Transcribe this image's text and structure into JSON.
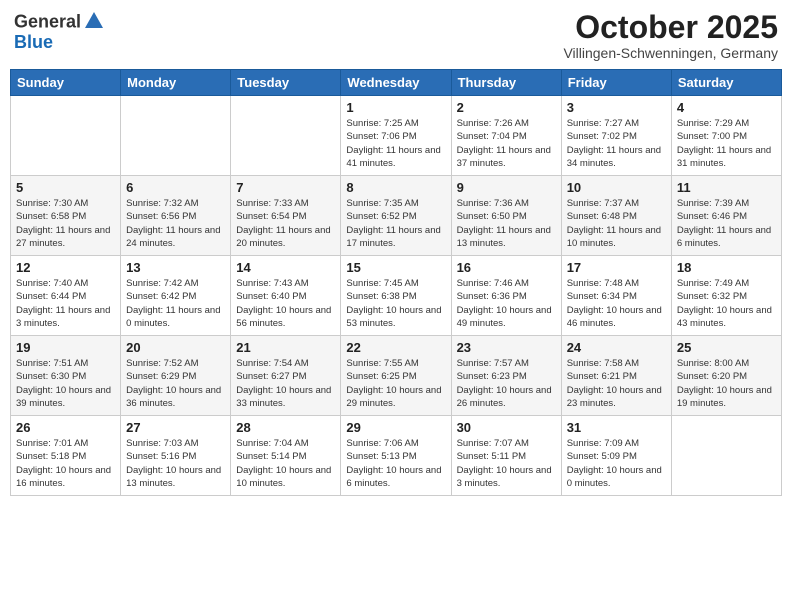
{
  "header": {
    "logo_general": "General",
    "logo_blue": "Blue",
    "month": "October 2025",
    "location": "Villingen-Schwenningen, Germany"
  },
  "weekdays": [
    "Sunday",
    "Monday",
    "Tuesday",
    "Wednesday",
    "Thursday",
    "Friday",
    "Saturday"
  ],
  "weeks": [
    [
      {
        "day": "",
        "info": ""
      },
      {
        "day": "",
        "info": ""
      },
      {
        "day": "",
        "info": ""
      },
      {
        "day": "1",
        "info": "Sunrise: 7:25 AM\nSunset: 7:06 PM\nDaylight: 11 hours\nand 41 minutes."
      },
      {
        "day": "2",
        "info": "Sunrise: 7:26 AM\nSunset: 7:04 PM\nDaylight: 11 hours\nand 37 minutes."
      },
      {
        "day": "3",
        "info": "Sunrise: 7:27 AM\nSunset: 7:02 PM\nDaylight: 11 hours\nand 34 minutes."
      },
      {
        "day": "4",
        "info": "Sunrise: 7:29 AM\nSunset: 7:00 PM\nDaylight: 11 hours\nand 31 minutes."
      }
    ],
    [
      {
        "day": "5",
        "info": "Sunrise: 7:30 AM\nSunset: 6:58 PM\nDaylight: 11 hours\nand 27 minutes."
      },
      {
        "day": "6",
        "info": "Sunrise: 7:32 AM\nSunset: 6:56 PM\nDaylight: 11 hours\nand 24 minutes."
      },
      {
        "day": "7",
        "info": "Sunrise: 7:33 AM\nSunset: 6:54 PM\nDaylight: 11 hours\nand 20 minutes."
      },
      {
        "day": "8",
        "info": "Sunrise: 7:35 AM\nSunset: 6:52 PM\nDaylight: 11 hours\nand 17 minutes."
      },
      {
        "day": "9",
        "info": "Sunrise: 7:36 AM\nSunset: 6:50 PM\nDaylight: 11 hours\nand 13 minutes."
      },
      {
        "day": "10",
        "info": "Sunrise: 7:37 AM\nSunset: 6:48 PM\nDaylight: 11 hours\nand 10 minutes."
      },
      {
        "day": "11",
        "info": "Sunrise: 7:39 AM\nSunset: 6:46 PM\nDaylight: 11 hours\nand 6 minutes."
      }
    ],
    [
      {
        "day": "12",
        "info": "Sunrise: 7:40 AM\nSunset: 6:44 PM\nDaylight: 11 hours\nand 3 minutes."
      },
      {
        "day": "13",
        "info": "Sunrise: 7:42 AM\nSunset: 6:42 PM\nDaylight: 11 hours\nand 0 minutes."
      },
      {
        "day": "14",
        "info": "Sunrise: 7:43 AM\nSunset: 6:40 PM\nDaylight: 10 hours\nand 56 minutes."
      },
      {
        "day": "15",
        "info": "Sunrise: 7:45 AM\nSunset: 6:38 PM\nDaylight: 10 hours\nand 53 minutes."
      },
      {
        "day": "16",
        "info": "Sunrise: 7:46 AM\nSunset: 6:36 PM\nDaylight: 10 hours\nand 49 minutes."
      },
      {
        "day": "17",
        "info": "Sunrise: 7:48 AM\nSunset: 6:34 PM\nDaylight: 10 hours\nand 46 minutes."
      },
      {
        "day": "18",
        "info": "Sunrise: 7:49 AM\nSunset: 6:32 PM\nDaylight: 10 hours\nand 43 minutes."
      }
    ],
    [
      {
        "day": "19",
        "info": "Sunrise: 7:51 AM\nSunset: 6:30 PM\nDaylight: 10 hours\nand 39 minutes."
      },
      {
        "day": "20",
        "info": "Sunrise: 7:52 AM\nSunset: 6:29 PM\nDaylight: 10 hours\nand 36 minutes."
      },
      {
        "day": "21",
        "info": "Sunrise: 7:54 AM\nSunset: 6:27 PM\nDaylight: 10 hours\nand 33 minutes."
      },
      {
        "day": "22",
        "info": "Sunrise: 7:55 AM\nSunset: 6:25 PM\nDaylight: 10 hours\nand 29 minutes."
      },
      {
        "day": "23",
        "info": "Sunrise: 7:57 AM\nSunset: 6:23 PM\nDaylight: 10 hours\nand 26 minutes."
      },
      {
        "day": "24",
        "info": "Sunrise: 7:58 AM\nSunset: 6:21 PM\nDaylight: 10 hours\nand 23 minutes."
      },
      {
        "day": "25",
        "info": "Sunrise: 8:00 AM\nSunset: 6:20 PM\nDaylight: 10 hours\nand 19 minutes."
      }
    ],
    [
      {
        "day": "26",
        "info": "Sunrise: 7:01 AM\nSunset: 5:18 PM\nDaylight: 10 hours\nand 16 minutes."
      },
      {
        "day": "27",
        "info": "Sunrise: 7:03 AM\nSunset: 5:16 PM\nDaylight: 10 hours\nand 13 minutes."
      },
      {
        "day": "28",
        "info": "Sunrise: 7:04 AM\nSunset: 5:14 PM\nDaylight: 10 hours\nand 10 minutes."
      },
      {
        "day": "29",
        "info": "Sunrise: 7:06 AM\nSunset: 5:13 PM\nDaylight: 10 hours\nand 6 minutes."
      },
      {
        "day": "30",
        "info": "Sunrise: 7:07 AM\nSunset: 5:11 PM\nDaylight: 10 hours\nand 3 minutes."
      },
      {
        "day": "31",
        "info": "Sunrise: 7:09 AM\nSunset: 5:09 PM\nDaylight: 10 hours\nand 0 minutes."
      },
      {
        "day": "",
        "info": ""
      }
    ]
  ]
}
